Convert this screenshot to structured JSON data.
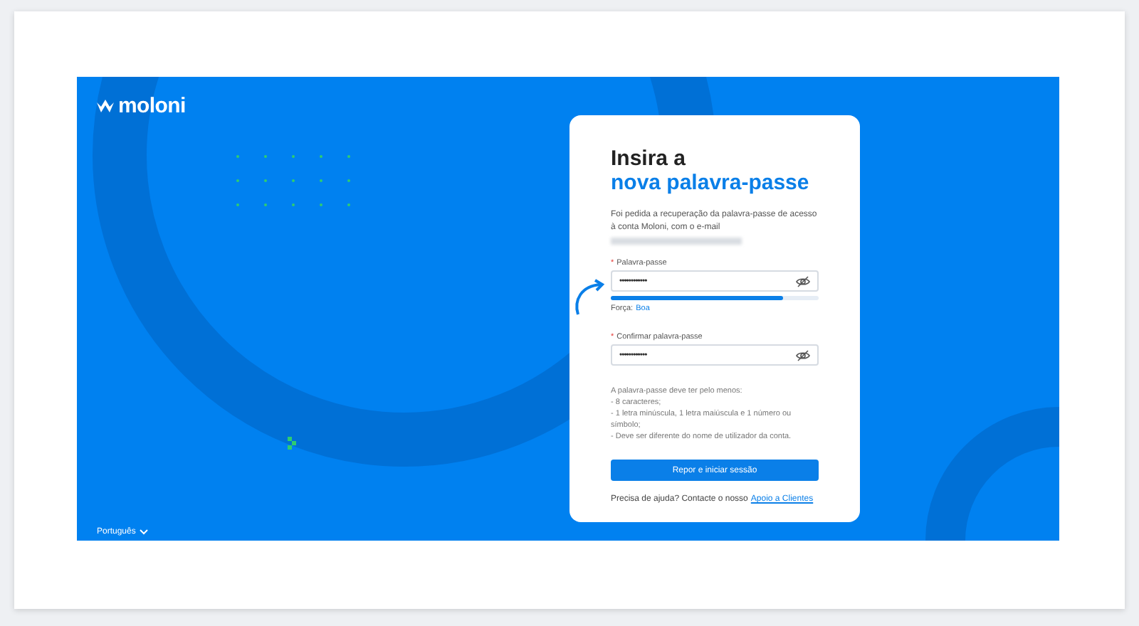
{
  "brand": {
    "name": "moloni"
  },
  "language": {
    "label": "Português"
  },
  "card": {
    "title_line1": "Insira a",
    "title_line2": "nova palavra-passe",
    "intro": "Foi pedida a recuperação da palavra-passe de acesso à conta Moloni, com o e-mail",
    "password": {
      "label": "Palavra-passe",
      "required_mark": "*",
      "value": "••••••••••••"
    },
    "strength": {
      "level": 0.83,
      "label": "Força:",
      "value": "Boa"
    },
    "confirm": {
      "label": "Confirmar palavra-passe",
      "required_mark": "*",
      "value": "••••••••••••"
    },
    "rules_intro": "A palavra-passe deve ter pelo menos:",
    "rules": [
      "- 8 caracteres;",
      "- 1 letra minúscula, 1 letra maiúscula e 1 número ou símbolo;",
      "- Deve ser diferente do nome de utilizador da conta."
    ],
    "submit": "Repor e iniciar sessão",
    "help": "Precisa de ajuda? Contacte o nosso",
    "help_link": "Apoio a Clientes"
  }
}
